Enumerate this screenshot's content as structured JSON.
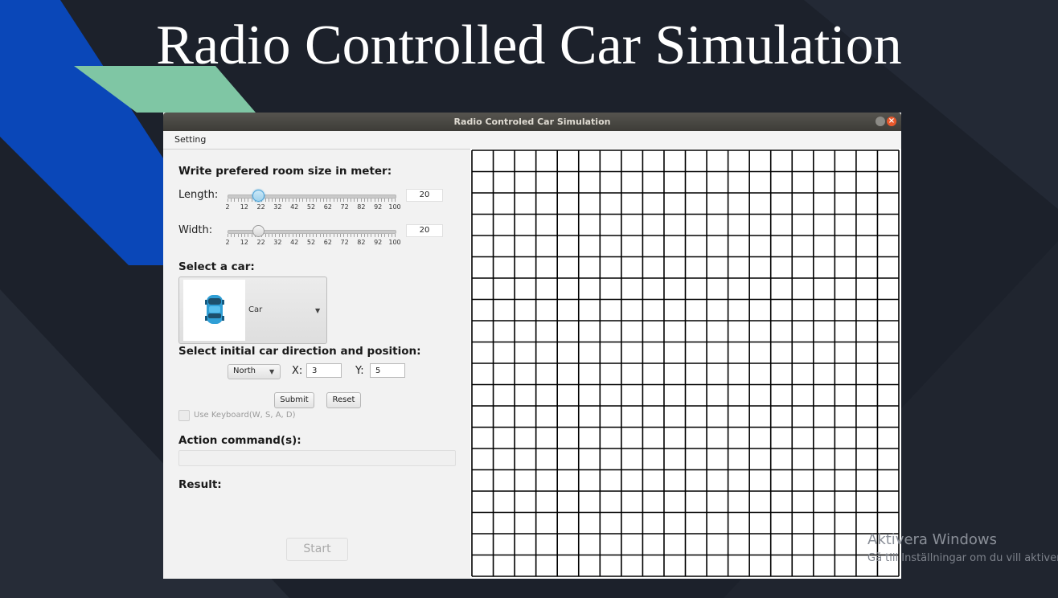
{
  "slide": {
    "title": "Radio Controlled Car Simulation",
    "colors": {
      "background": "#1c212b",
      "blue_band": "#0a47b8",
      "green_band": "#7fc6a4"
    }
  },
  "watermark": {
    "line1": "Aktivera Windows",
    "line2": "Gå till Inställningar om du vill aktivera Windows."
  },
  "window": {
    "title": "Radio Controled Car Simulation",
    "close_glyph": "×",
    "menu": [
      "Setting"
    ]
  },
  "room": {
    "heading": "Write prefered room size in meter:",
    "length_label": "Length:",
    "width_label": "Width:",
    "tick_labels": [
      "2",
      "12",
      "22",
      "32",
      "42",
      "52",
      "62",
      "72",
      "82",
      "92",
      "100"
    ],
    "slider_min": 2,
    "slider_max": 100,
    "length_value": "20",
    "width_value": "20"
  },
  "car": {
    "heading": "Select a car:",
    "selected": "Car",
    "icon": "car-icon",
    "arrow_glyph": "▼"
  },
  "position": {
    "heading": "Select initial car direction and position:",
    "direction": "North",
    "x_label": "X:",
    "x_value": "3",
    "y_label": "Y:",
    "y_value": "5"
  },
  "buttons": {
    "submit": "Submit",
    "reset": "Reset",
    "start": "Start"
  },
  "keyboard": {
    "label": "Use Keyboard(W, S, A, D)",
    "checked": false
  },
  "action": {
    "heading": "Action command(s):",
    "value": ""
  },
  "result": {
    "heading": "Result:"
  },
  "grid": {
    "columns": 20,
    "rows": 20,
    "line_color": "#000000"
  }
}
